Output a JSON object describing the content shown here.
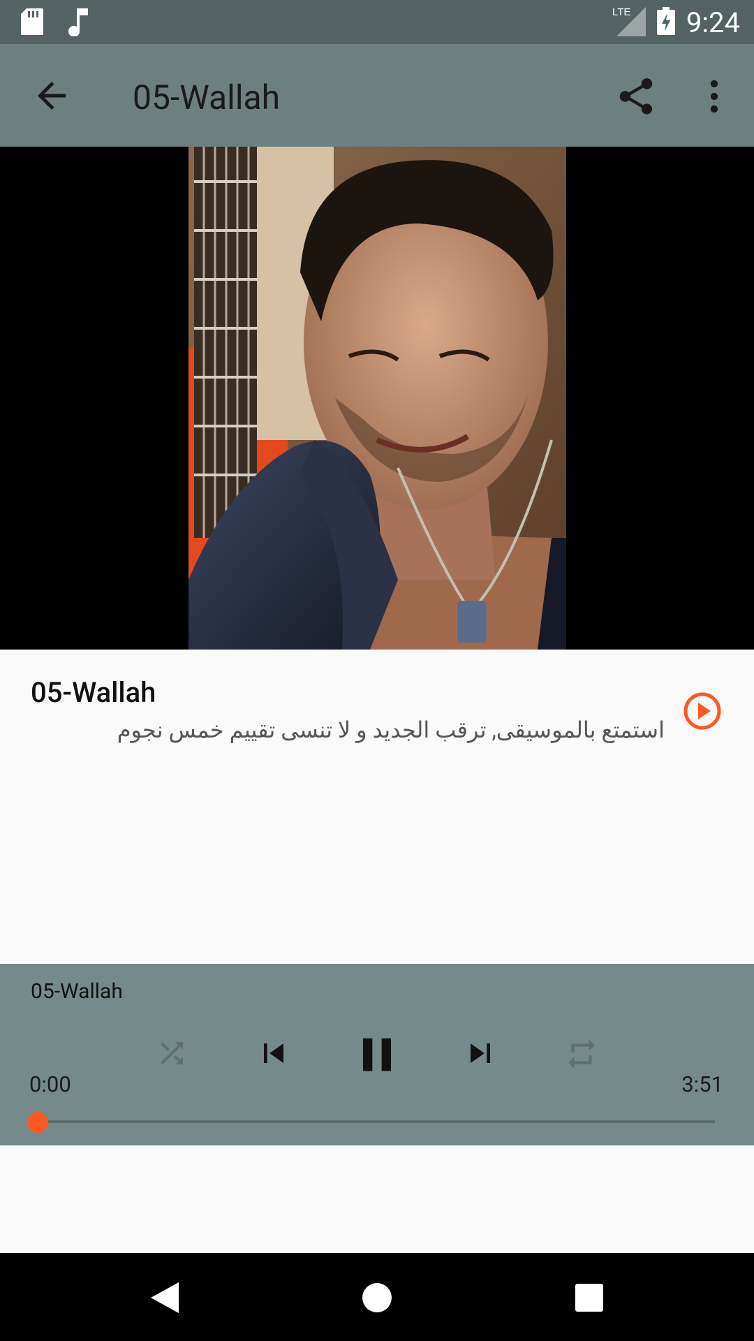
{
  "status_bar": {
    "time": "9:24",
    "network": "LTE",
    "icons": [
      "sd-card-icon",
      "music-note-icon",
      "signal-icon",
      "battery-charging-icon"
    ]
  },
  "app_bar": {
    "title": "05-Wallah",
    "icons": [
      "back-arrow-icon",
      "share-icon",
      "more-vert-icon"
    ]
  },
  "track_info": {
    "title": "05-Wallah",
    "subtitle": "استمتع بالموسيقى, ترقب الجديد و لا تنسى تقييم خمس نجوم"
  },
  "player": {
    "title": "05-Wallah",
    "current_time": "0:00",
    "duration": "3:51",
    "progress": 0,
    "controls": [
      "shuffle-icon",
      "skip-previous-icon",
      "pause-icon",
      "skip-next-icon",
      "repeat-icon"
    ]
  },
  "colors": {
    "status_bar": "#536363",
    "app_bar": "#6d8080",
    "player_bg": "#758a8a",
    "accent": "#ff5722"
  }
}
